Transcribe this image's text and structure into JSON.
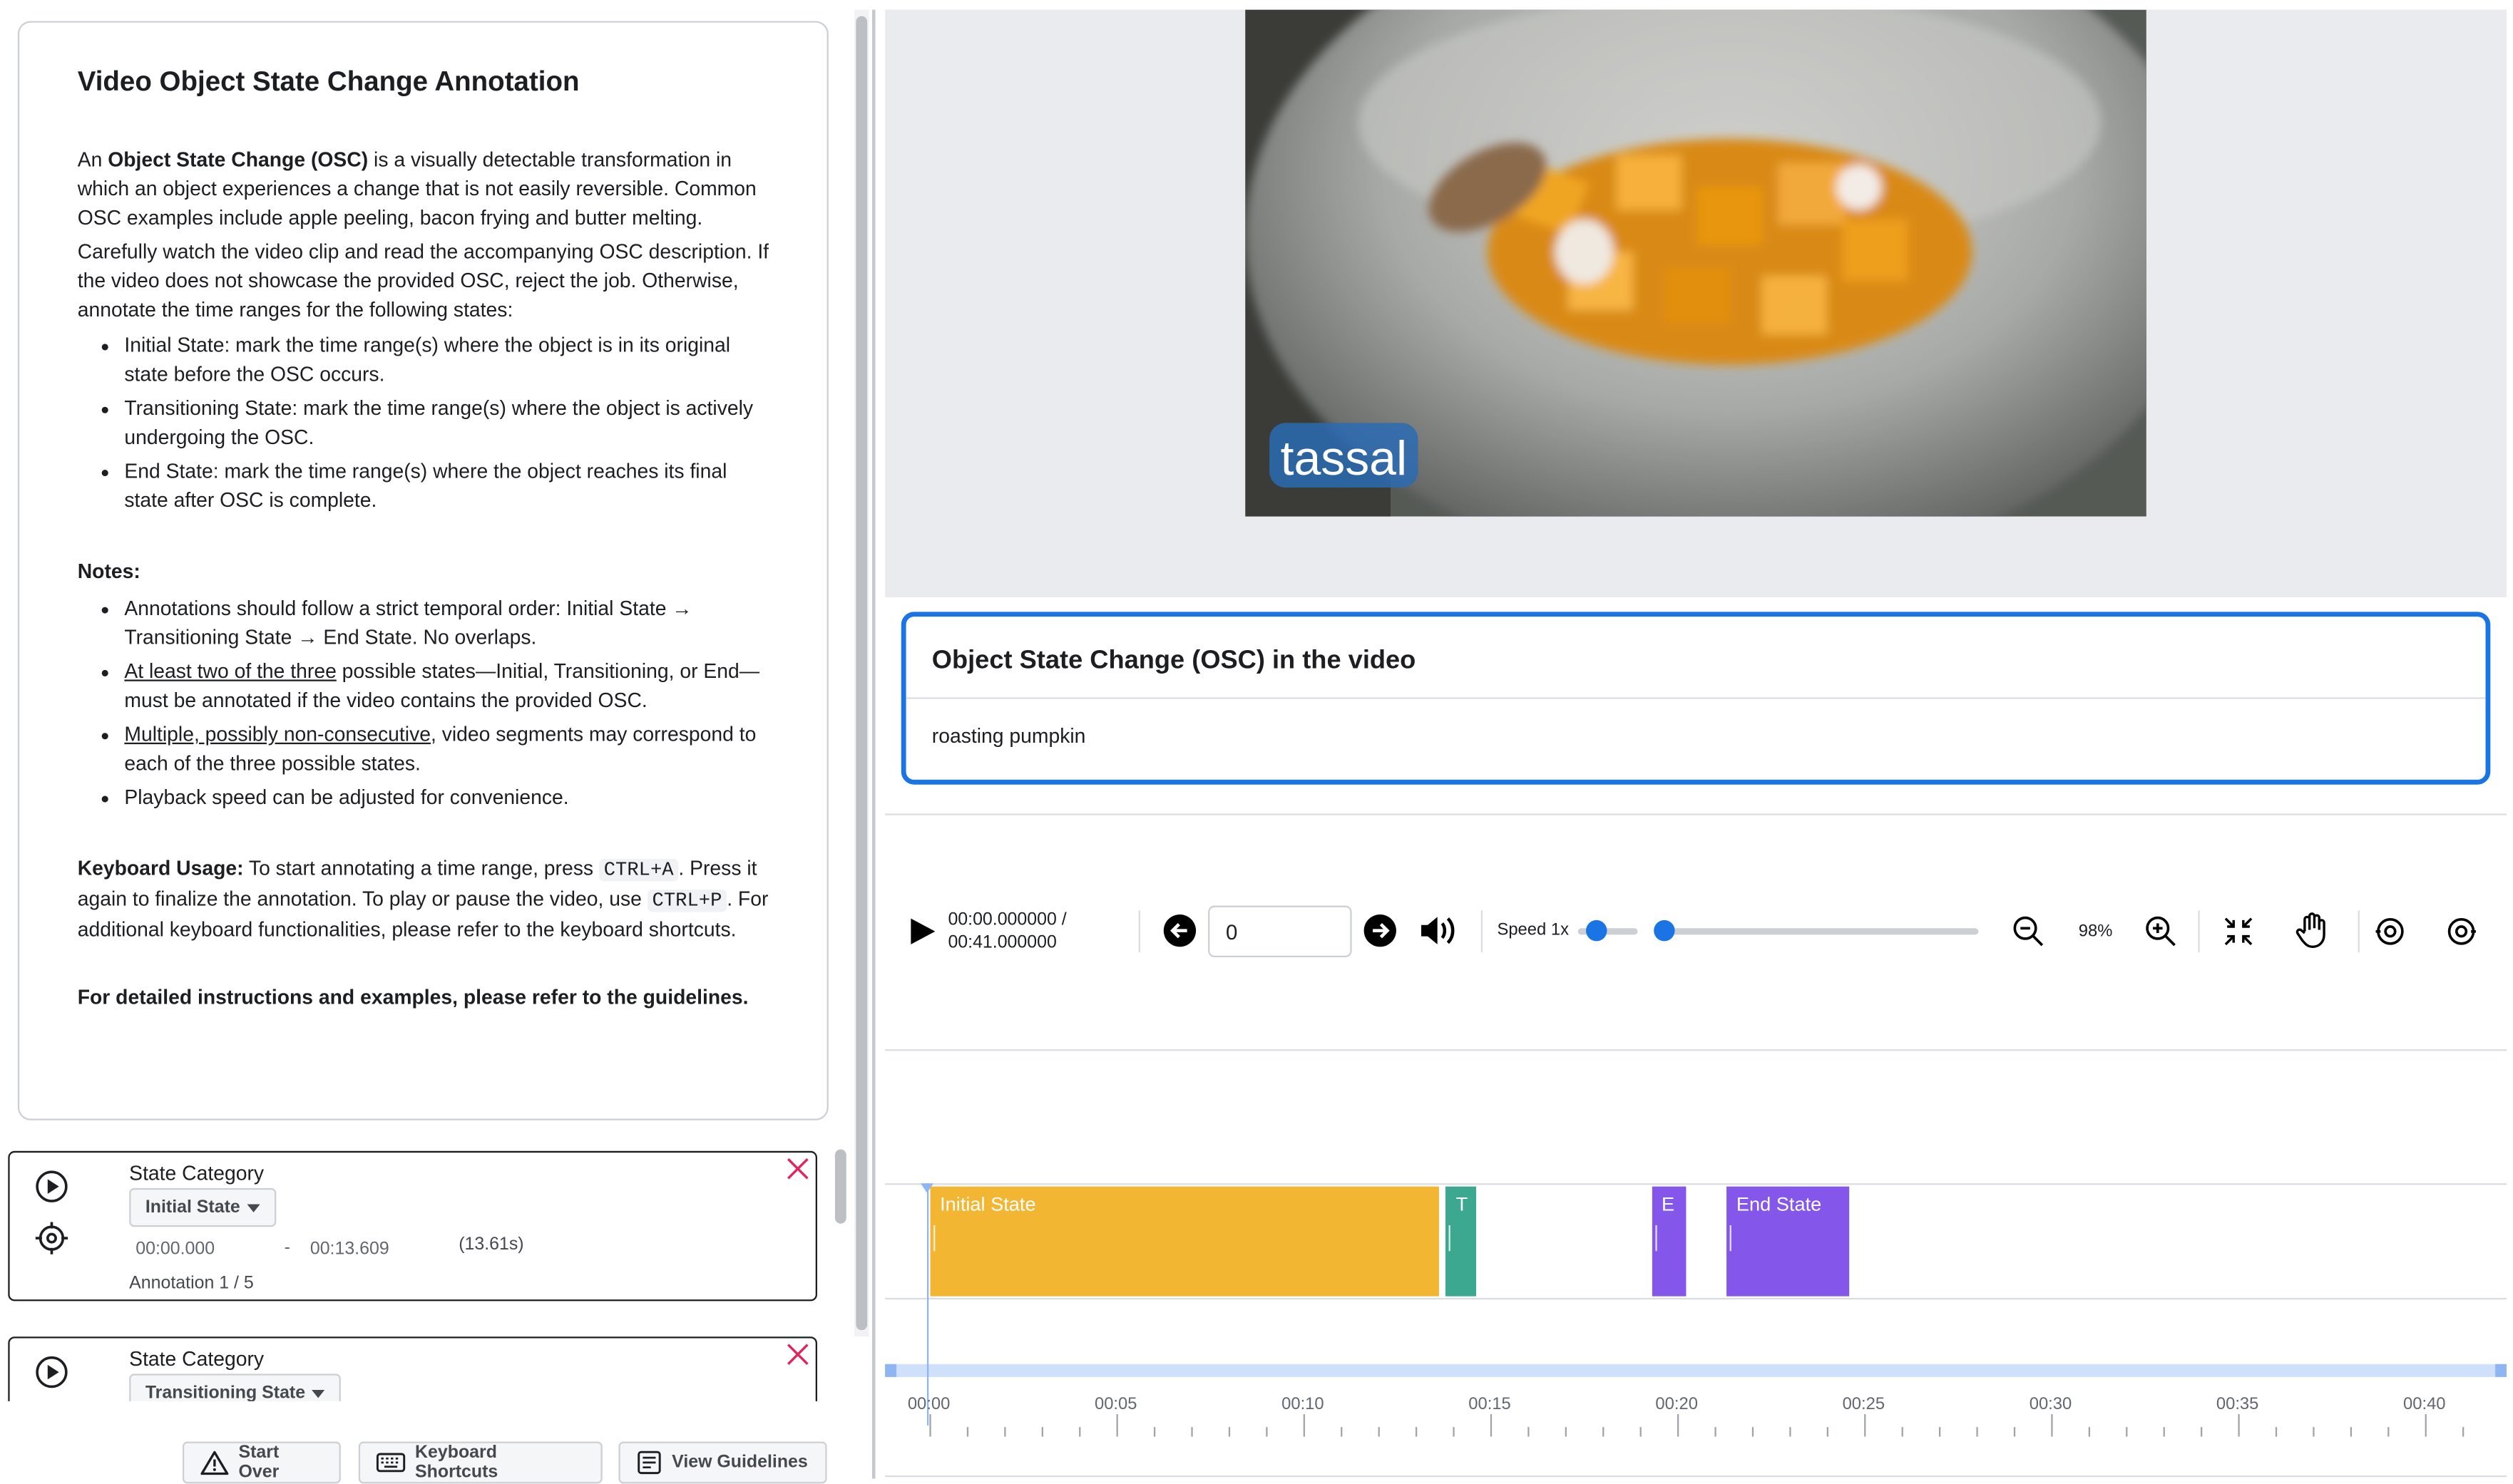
{
  "instructions": {
    "title": "Video Object State Change Annotation",
    "intro_prefix": "An ",
    "intro_bold": "Object State Change (OSC)",
    "intro_rest": " is a visually detectable transformation in which an object experiences a change that is not easily reversible. Common OSC examples include apple peeling, bacon frying and butter melting.",
    "para2": "Carefully watch the video clip and read the accompanying OSC description. If the video does not showcase the provided OSC, reject the job. Otherwise, annotate the time ranges for the following states:",
    "states": [
      "Initial State: mark the time range(s) where the object is in its original state before the OSC occurs.",
      "Transitioning State: mark the time range(s) where the object is actively undergoing the OSC.",
      "End State: mark the time range(s) where the object reaches its final state after OSC is complete."
    ],
    "notes_title": "Notes:",
    "note1": "Annotations should follow a strict temporal order: Initial State → Transitioning State → End State. No overlaps.",
    "note2_u": "At least two of the three",
    "note2_rest": " possible states—Initial, Transitioning, or End—must be annotated if the video contains the provided OSC.",
    "note3_u": "Multiple, possibly non-consecutive",
    "note3_rest": ", video segments may correspond to each of the three possible states.",
    "note4": "Playback speed can be adjusted for convenience.",
    "kb_bold": "Keyboard Usage:",
    "kb_1": " To start annotating a time range, press ",
    "kb_code1": "CTRL+A",
    "kb_2": ". Press it again to finalize the annotation. To play or pause the video, use ",
    "kb_code2": "CTRL+P",
    "kb_3": ". For additional keyboard functionalities, please refer to the keyboard shortcuts.",
    "guidelines": "For detailed instructions and examples, please refer to the guidelines."
  },
  "annotations": [
    {
      "label": "State Category",
      "value": "Initial State",
      "start": "00:00.000",
      "dash": "-",
      "end": "00:13.609",
      "duration": "(13.61s)",
      "counter": "Annotation 1 / 5"
    },
    {
      "label": "State Category",
      "value": "Transitioning State"
    }
  ],
  "footer": {
    "start_over": "Start Over",
    "shortcuts": "Keyboard Shortcuts",
    "guidelines": "View Guidelines"
  },
  "video": {
    "watermark": "tassal"
  },
  "osc": {
    "title": "Object State Change (OSC) in the video",
    "text": "roasting pumpkin"
  },
  "controls": {
    "time_current": "00:00.000000 /",
    "time_total": "00:41.000000",
    "frame_value": "0",
    "speed_label": "Speed 1x",
    "speed": 1,
    "zoom_label": "98%",
    "playback_progress": 0
  },
  "timeline": {
    "duration_s": 41,
    "segments": [
      {
        "label": "Initial State",
        "start": 0.0,
        "end": 13.609,
        "color": "#f2b632"
      },
      {
        "label": "T",
        "start": 13.8,
        "end": 14.6,
        "color": "#3ba88f"
      },
      {
        "label": "E",
        "start": 19.3,
        "end": 20.2,
        "color": "#8456ea"
      },
      {
        "label": "End State",
        "start": 21.3,
        "end": 24.6,
        "color": "#8456ea"
      }
    ],
    "tick_labels": [
      "00:00",
      "00:05",
      "00:10",
      "00:15",
      "00:20",
      "00:25",
      "00:30",
      "00:35",
      "00:40"
    ]
  },
  "colors": {
    "accent": "#1b74e4",
    "delete": "#e0245e"
  }
}
